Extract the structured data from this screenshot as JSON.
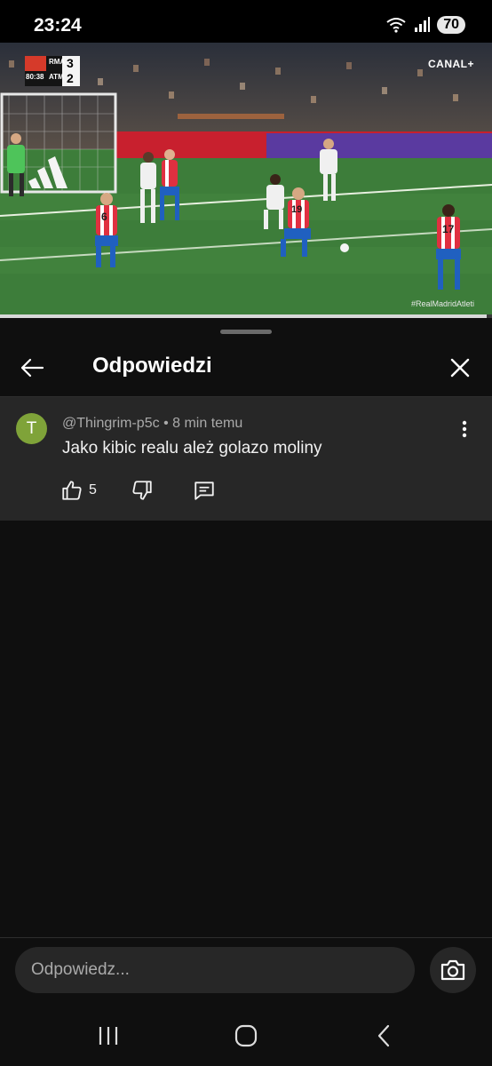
{
  "status_bar": {
    "time": "23:24",
    "battery": "70",
    "icons": [
      "wifi-icon",
      "signal-icon",
      "battery-icon"
    ]
  },
  "video": {
    "scoreboard": {
      "home_team": "RMA",
      "home_score": "3",
      "away_team": "ATM",
      "away_score": "2",
      "clock": "80:38"
    },
    "channel": "CANAL+",
    "hashtag": "#RealMadridAtleti",
    "jersey_numbers": [
      "6",
      "19",
      "17"
    ],
    "progress": 0.99
  },
  "sheet": {
    "title": "Odpowiedzi"
  },
  "comment": {
    "avatar_letter": "T",
    "author": "@Thingrim-p5c",
    "separator": "•",
    "time": "8 min temu",
    "text": "Jako kibic realu ależ golazo moliny",
    "likes": "5"
  },
  "reply": {
    "placeholder": "Odpowiedz..."
  },
  "colors": {
    "avatar": "#7fa339",
    "background": "#0f0f0f",
    "comment_bg": "#272727",
    "pitch": "#3d7d3a"
  }
}
